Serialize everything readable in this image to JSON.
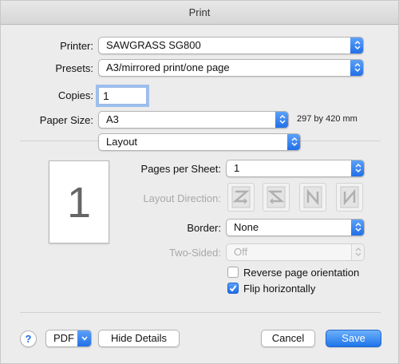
{
  "window": {
    "title": "Print"
  },
  "printer": {
    "label": "Printer:",
    "value": "SAWGRASS SG800"
  },
  "presets": {
    "label": "Presets:",
    "value": "A3/mirrored print/one page"
  },
  "copies": {
    "label": "Copies:",
    "value": "1"
  },
  "paper_size": {
    "label": "Paper Size:",
    "value": "A3",
    "dimensions": "297 by 420 mm"
  },
  "section": {
    "value": "Layout"
  },
  "preview": {
    "page_number": "1"
  },
  "pages_per_sheet": {
    "label": "Pages per Sheet:",
    "value": "1"
  },
  "layout_direction": {
    "label": "Layout Direction:",
    "options": [
      "z-order-icon",
      "reverse-z-order-icon",
      "n-order-icon",
      "reverse-n-order-icon"
    ]
  },
  "border": {
    "label": "Border:",
    "value": "None"
  },
  "two_sided": {
    "label": "Two-Sided:",
    "value": "Off"
  },
  "reverse_orientation": {
    "label": "Reverse page orientation",
    "checked": false
  },
  "flip_horizontally": {
    "label": "Flip horizontally",
    "checked": true
  },
  "footer": {
    "help_label": "?",
    "pdf_label": "PDF",
    "hide_details_label": "Hide Details",
    "cancel_label": "Cancel",
    "save_label": "Save"
  },
  "colors": {
    "accent": "#1f6de8",
    "disabled_text": "#a8a8a8"
  }
}
